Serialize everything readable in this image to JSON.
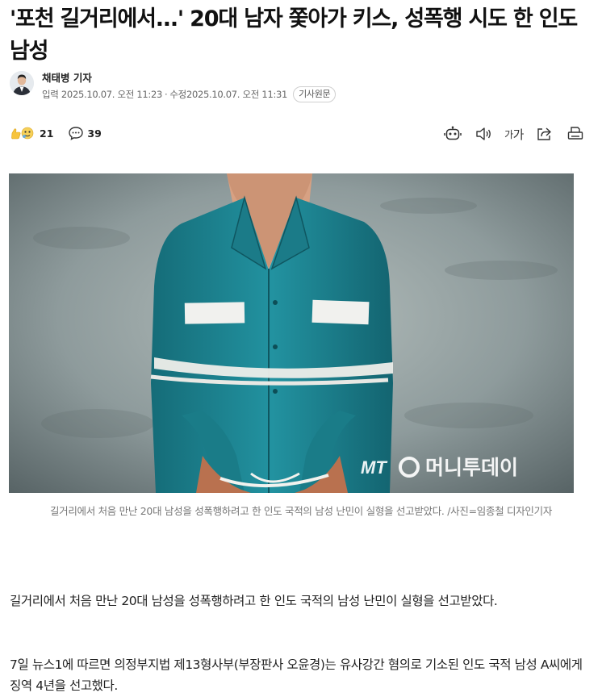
{
  "article": {
    "title": "'포천 길거리에서...' 20대 남자 쫓아가 키스, 성폭행 시도 한 인도 남성"
  },
  "byline": {
    "reporter": "채태병 기자",
    "published": "입력 2025.10.07. 오전 11:23",
    "separator": "·",
    "modified": "수정2025.10.07. 오전 11:31",
    "original_button": "기사원문"
  },
  "stats": {
    "reactions_count": "21",
    "comments_count": "39"
  },
  "tools": {
    "summary_icon": "robot-icon",
    "audio_icon": "speaker-icon",
    "font_size_small": "가",
    "font_size_large": "가",
    "share_icon": "share-icon",
    "print_icon": "print-icon"
  },
  "photo": {
    "watermark_mt": "MT",
    "watermark_brand": "머니투데이"
  },
  "caption": "길거리에서 처음 만난 20대 남성을 성폭행하려고 한 인도 국적의 남성 난민이 실형을 선고받았다. /사진=임종철 디자인기자",
  "paragraphs": [
    "길거리에서 처음 만난 20대 남성을 성폭행하려고 한 인도 국적의 남성 난민이 실형을 선고받았다.",
    "7일 뉴스1에 따르면 의정부지법 제13형사부(부장판사 오윤경)는 유사강간 혐의로 기소된 인도 국적 남성 A씨에게 징역 4년을 선고했다."
  ],
  "colors": {
    "shirt": "#1f8a96",
    "wall": "#7d8b8d",
    "text": "#222222",
    "muted": "#777777"
  }
}
